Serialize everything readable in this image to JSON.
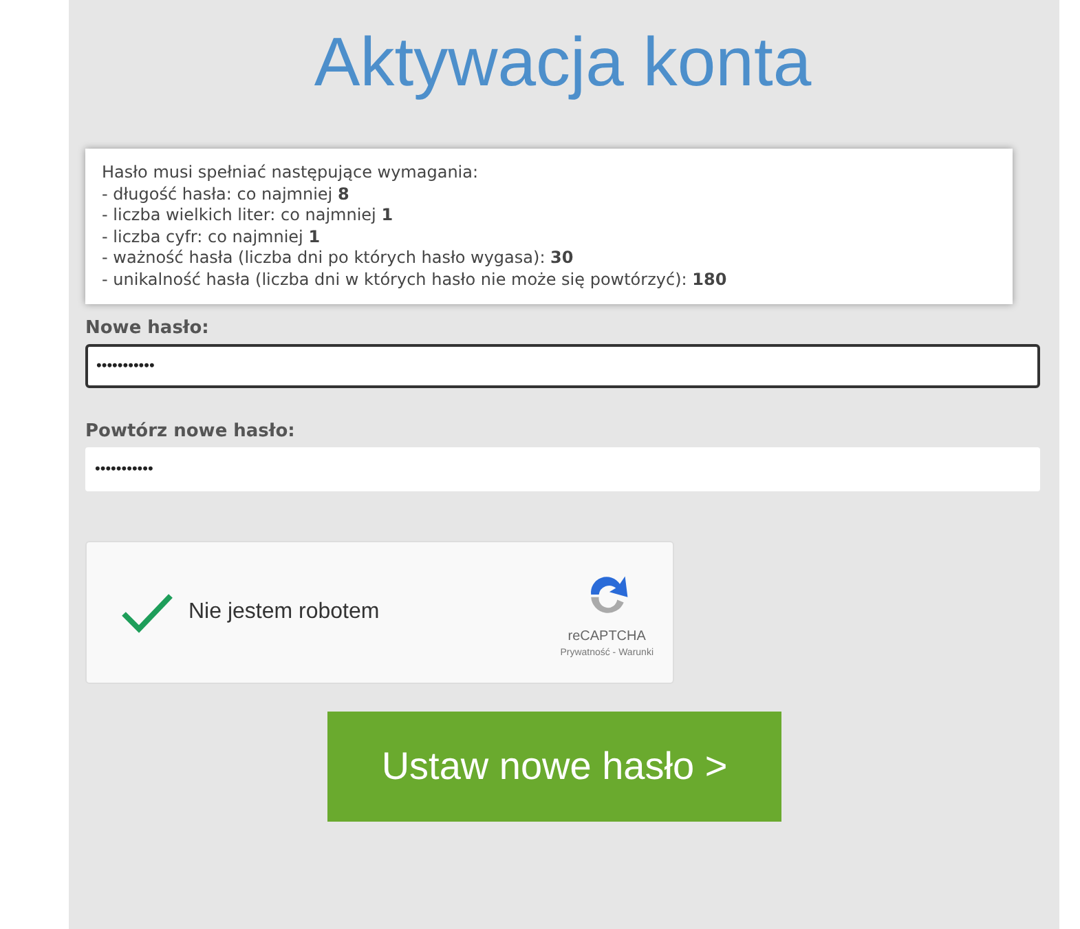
{
  "title": "Aktywacja konta",
  "requirements": {
    "heading": "Hasło musi spełniać następujące wymagania:",
    "items": [
      "- długość hasła: co najmniej **8**",
      "- liczba wielkich liter: co najmniej **1**",
      "- liczba cyfr: co najmniej **1**",
      "- ważność hasła (liczba dni po których hasło wygasa): **30**",
      "- unikalność hasła (liczba dni w których hasło nie może się powtórzyć): **180**"
    ]
  },
  "fields": [
    {
      "label": "Nowe hasło:",
      "value": "•••••••••••",
      "focused": true
    },
    {
      "label": "Powtórz nowe hasło:",
      "value": "•••••••••••",
      "focused": false
    }
  ],
  "captcha": {
    "label": "Nie jestem robotem",
    "checked": true,
    "brand": "reCAPTCHA",
    "links": "Prywatność - Warunki"
  },
  "submit": "Ustaw nowe hasło >"
}
